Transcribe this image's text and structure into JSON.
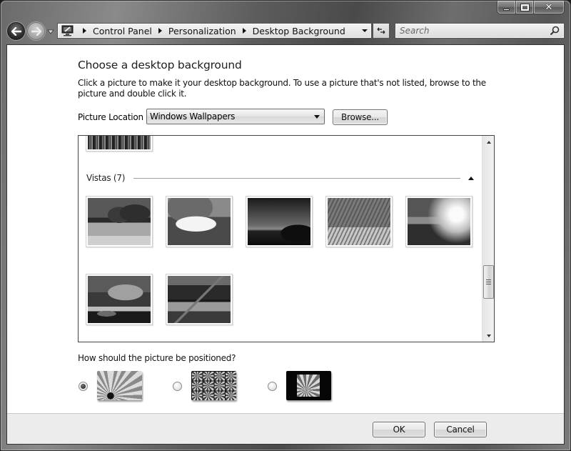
{
  "window": {
    "controls": {
      "minimize": "minimize",
      "maximize": "maximize",
      "close": "close"
    }
  },
  "nav": {
    "back_icon": "arrow-left-icon",
    "forward_icon": "arrow-right-icon",
    "recent_pages_icon": "chevron-down-icon"
  },
  "address": {
    "icon": "control-panel-icon",
    "breadcrumbs": [
      "Control Panel",
      "Personalization",
      "Desktop Background"
    ]
  },
  "search": {
    "placeholder": "Search",
    "value": ""
  },
  "page": {
    "title": "Choose a desktop background",
    "description": "Click a picture to make it your desktop background. To use a picture that's not listed, browse to the picture and double click it.",
    "location_label": "Picture Location",
    "location_value": "Windows Wallpapers",
    "browse_label": "Browse..."
  },
  "gallery": {
    "group": {
      "label": "Vistas (7)",
      "name": "Vistas",
      "count": 7
    },
    "items": [
      {
        "name": "vista-river-karst"
      },
      {
        "name": "vista-rock-arch"
      },
      {
        "name": "vista-dusk-hill"
      },
      {
        "name": "vista-palm-frond"
      },
      {
        "name": "vista-sunlit-field"
      },
      {
        "name": "vista-mountain-lake"
      },
      {
        "name": "vista-peak-reflection"
      }
    ]
  },
  "positioning": {
    "label": "How should the picture be positioned?",
    "options": [
      {
        "name": "fill",
        "checked": true
      },
      {
        "name": "tile",
        "checked": false
      },
      {
        "name": "center",
        "checked": false
      }
    ]
  },
  "footer": {
    "ok_label": "OK",
    "cancel_label": "Cancel"
  }
}
